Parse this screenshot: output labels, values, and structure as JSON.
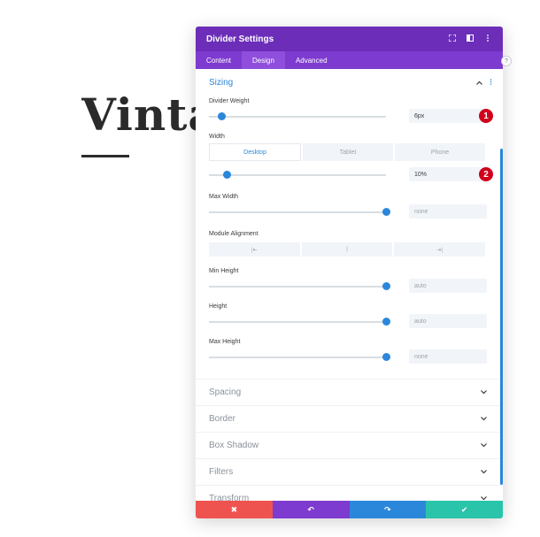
{
  "background": {
    "heading": "Vintag"
  },
  "panel": {
    "title": "Divider Settings",
    "header_icons": [
      "fullscreen-icon",
      "split-view-icon",
      "more-vertical-icon"
    ],
    "tabs": [
      {
        "label": "Content",
        "active": false
      },
      {
        "label": "Design",
        "active": true
      },
      {
        "label": "Advanced",
        "active": false
      }
    ],
    "colors": {
      "header": "#6c2eb9",
      "tabs": "#7e3bd0",
      "accent": "#2b87da",
      "cancel": "#ef5350",
      "undo": "#7e3bd0",
      "redo": "#2b87da",
      "save": "#29c4a9",
      "badge": "#d0021b"
    }
  },
  "sizing": {
    "title": "Sizing",
    "divider_weight": {
      "label": "Divider Weight",
      "value": "6px",
      "slider_fraction": 0.07,
      "badge": "1"
    },
    "width": {
      "label": "Width",
      "devices": [
        {
          "label": "Desktop",
          "active": true
        },
        {
          "label": "Tablet",
          "active": false
        },
        {
          "label": "Phone",
          "active": false
        }
      ],
      "value": "10%",
      "slider_fraction": 0.1,
      "badge": "2"
    },
    "max_width": {
      "label": "Max Width",
      "value": "none",
      "slider_fraction": 1.0
    },
    "module_alignment": {
      "label": "Module Alignment",
      "options": [
        "|⇤",
        "|",
        "⇥|"
      ]
    },
    "min_height": {
      "label": "Min Height",
      "value": "auto",
      "slider_fraction": 1.0
    },
    "height": {
      "label": "Height",
      "value": "auto",
      "slider_fraction": 1.0
    },
    "max_height": {
      "label": "Max Height",
      "value": "none",
      "slider_fraction": 1.0
    }
  },
  "collapsed_sections": [
    "Spacing",
    "Border",
    "Box Shadow",
    "Filters",
    "Transform"
  ],
  "footer": {
    "cancel": "✖",
    "undo": "↶",
    "redo": "↷",
    "save": "✔"
  }
}
